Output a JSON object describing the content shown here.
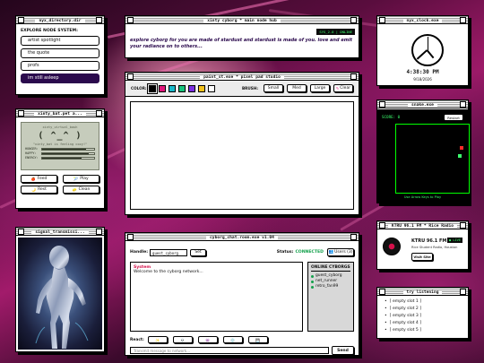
{
  "desktop": {
    "accent": "#2b0a4d",
    "background_colors": [
      "#5a0d3e",
      "#a21b6b",
      "#150312"
    ]
  },
  "directory": {
    "title": "nyx_directory.dir",
    "heading": "EXPLORE NODE SYSTEM:",
    "items": [
      {
        "label": "artist spotlight",
        "active": false
      },
      {
        "label": "the quote",
        "active": false
      },
      {
        "label": "profs",
        "active": false
      },
      {
        "label": "im still asleep",
        "active": true
      }
    ]
  },
  "hub": {
    "title": "xinty cyborg * main node hub",
    "version": "SYS_2.0 | ONLINE",
    "quote": "explore cyborg for you are made of stardust and stardust is made of you. love and emit your radiance on to others..."
  },
  "paint": {
    "title": "paint_st.exe * pixel pad studio",
    "color_label": "COLOR:",
    "colors": [
      "#000000",
      "#e0157a",
      "#19b8c9",
      "#16c27b",
      "#7b2fe0",
      "#f3c21b",
      "#ffffff"
    ],
    "brush_label": "BRUSH:",
    "brushes": [
      "Small",
      "Med",
      "Large"
    ],
    "clear_label": "Clear"
  },
  "pet": {
    "title": "xinty_bat.pet a...",
    "name": "xinty_virtual_bauh",
    "face": "( ^_^ )",
    "message": "\"xinty_bat is feeling cozy!\"",
    "stats": [
      {
        "label": "HUNGER:",
        "value": 0.85
      },
      {
        "label": "HAPPY:",
        "value": 0.9
      },
      {
        "label": "ENERGY:",
        "value": 0.75
      }
    ],
    "actions": [
      {
        "icon": "food-icon",
        "glyph": "🍎",
        "label": "Feed"
      },
      {
        "icon": "play-icon",
        "glyph": "🎾",
        "label": "Play"
      },
      {
        "icon": "rest-icon",
        "glyph": "🌙",
        "label": "Rest"
      },
      {
        "icon": "clean-icon",
        "glyph": "🧽",
        "label": "Clean"
      }
    ]
  },
  "signal": {
    "title": "signal_transmissi..."
  },
  "clock": {
    "title": "nyx_clock.exe",
    "time": "4:38:30 PM",
    "date": "9/18/2026"
  },
  "snake": {
    "title": "snake.exe",
    "score": "SCORE: 0",
    "restart": "Restart",
    "hint": "Use Arrow Keys to Play"
  },
  "chat": {
    "title": "cyborg_chat.room.exe v1.04",
    "handle_label": "Handle:",
    "handle_value": "guest_cyborg",
    "set_label": "Set",
    "status_label": "Status:",
    "status_value": "CONNECTED",
    "users_label": "Users (3)",
    "messages": [
      {
        "author": "System",
        "text": "Welcome to the cyborg network..."
      }
    ],
    "online_heading": "ONLINE CYBORGS",
    "online": [
      "guest_cyborg",
      "net_runner",
      "retro_fan99"
    ],
    "react_label": "React:",
    "reactions": [
      "✨",
      "💀",
      "👾",
      "💿",
      "💾"
    ],
    "input_placeholder": "Transmit message to network...",
    "send_label": "Send"
  },
  "radio": {
    "title": "KTRU 96.1 FM * Rice Radio",
    "station": "KTRU 96.1 FM",
    "live": "● LIVE",
    "desc": "Rice Student Radio, Houston",
    "button": "Visit Site"
  },
  "listening": {
    "title": "try listening",
    "slots": [
      "[ empty slot 1 ]",
      "[ empty slot 2 ]",
      "[ empty slot 3 ]",
      "[ empty slot 4 ]",
      "[ empty slot 5 ]"
    ]
  }
}
